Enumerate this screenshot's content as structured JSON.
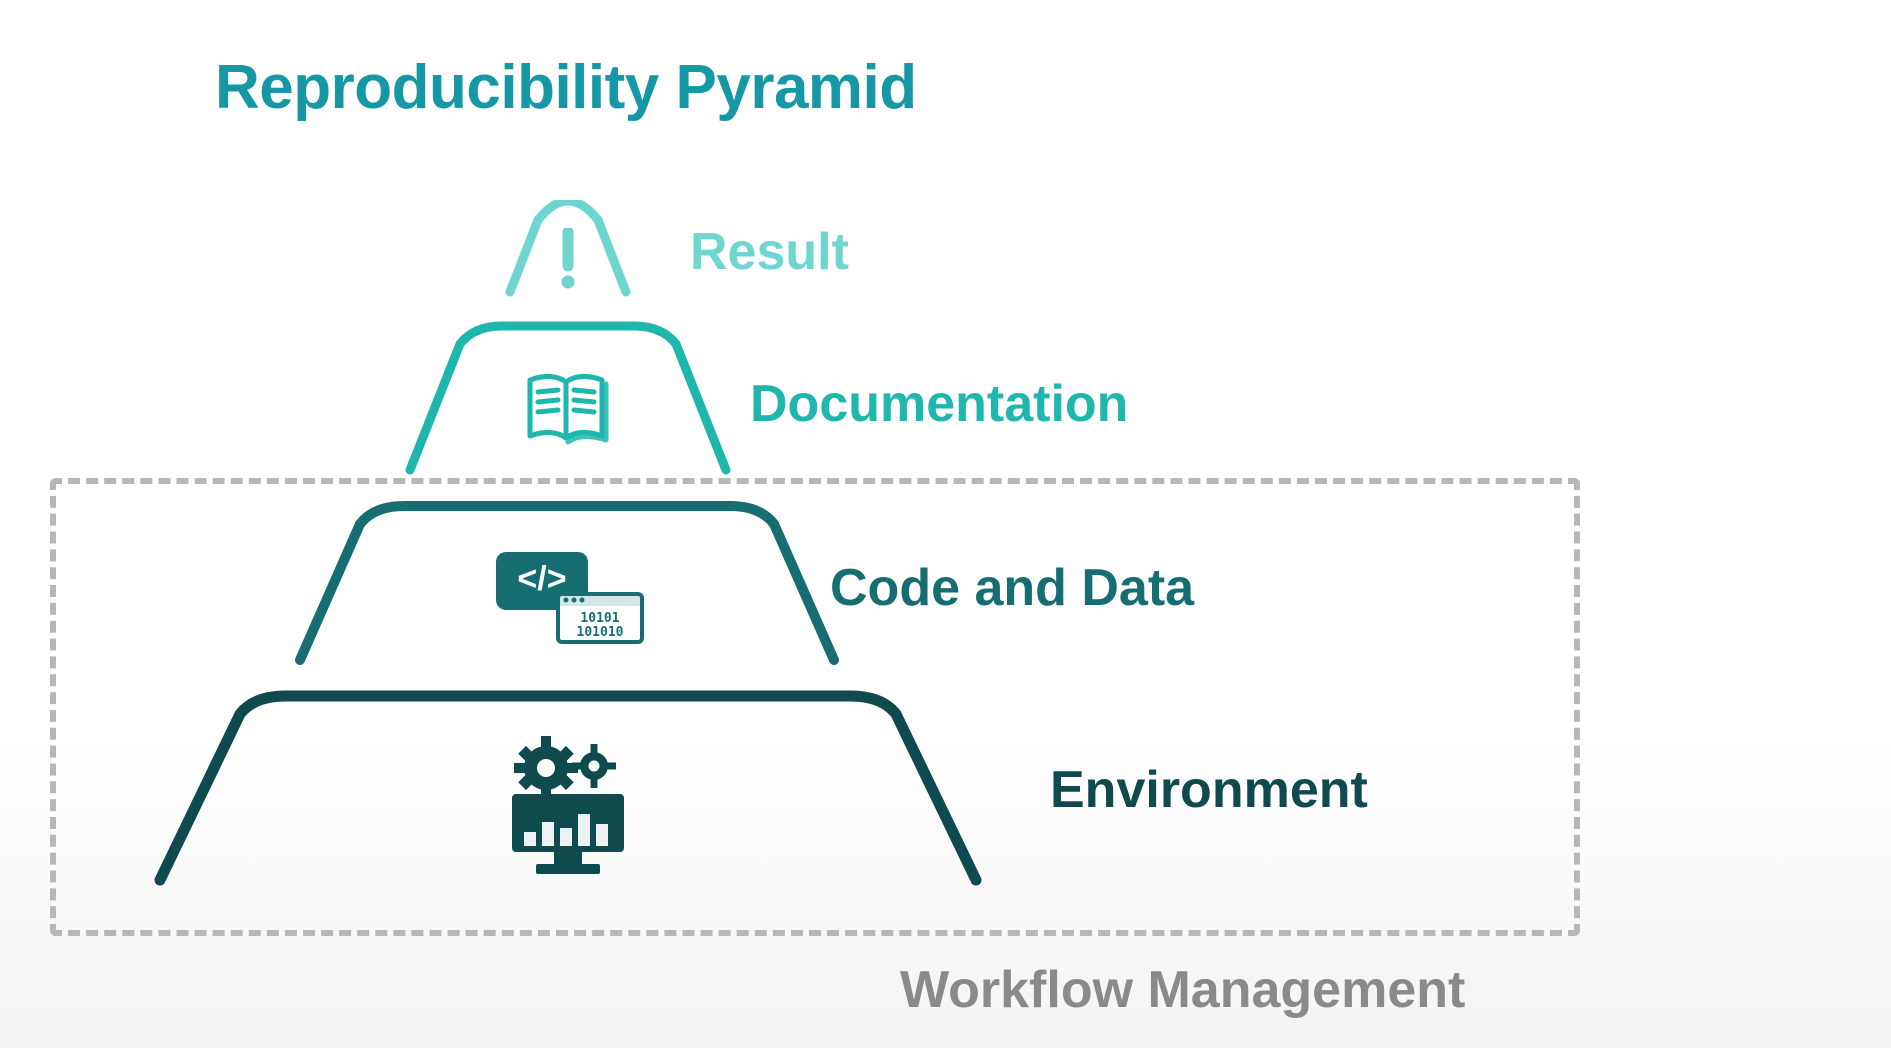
{
  "title": "Reproducibility Pyramid",
  "tiers": [
    {
      "label": "Result",
      "color": "#6fd6cf",
      "labelColor": "#6fd6cf",
      "icon": "exclaim"
    },
    {
      "label": "Documentation",
      "color": "#1fb6ad",
      "labelColor": "#1fb6ad",
      "icon": "book"
    },
    {
      "label": "Code and Data",
      "color": "#166e73",
      "labelColor": "#166e73",
      "icon": "code"
    },
    {
      "label": "Environment",
      "color": "#0f4a4e",
      "labelColor": "#0f4a4e",
      "icon": "env"
    }
  ],
  "box_label": "Workflow Management",
  "box_label_color": "#8a8a8a",
  "dashed_color": "#b7b7b7"
}
